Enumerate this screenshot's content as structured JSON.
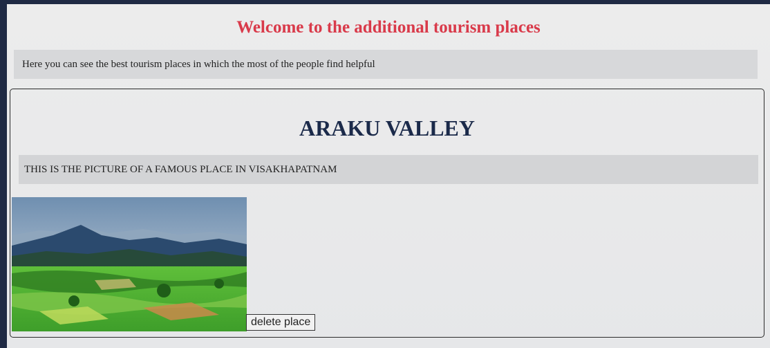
{
  "header": {
    "title": "Welcome to the additional tourism places"
  },
  "intro": {
    "text": "Here you can see the best tourism places in which the most of the people find helpful"
  },
  "place": {
    "name": "ARAKU VALLEY",
    "description": "THIS IS THE PICTURE OF A FAMOUS PLACE IN VISAKHAPATNAM",
    "delete_label": "delete place"
  },
  "colors": {
    "title": "#d93a4a",
    "place_title": "#1b2a4a"
  }
}
